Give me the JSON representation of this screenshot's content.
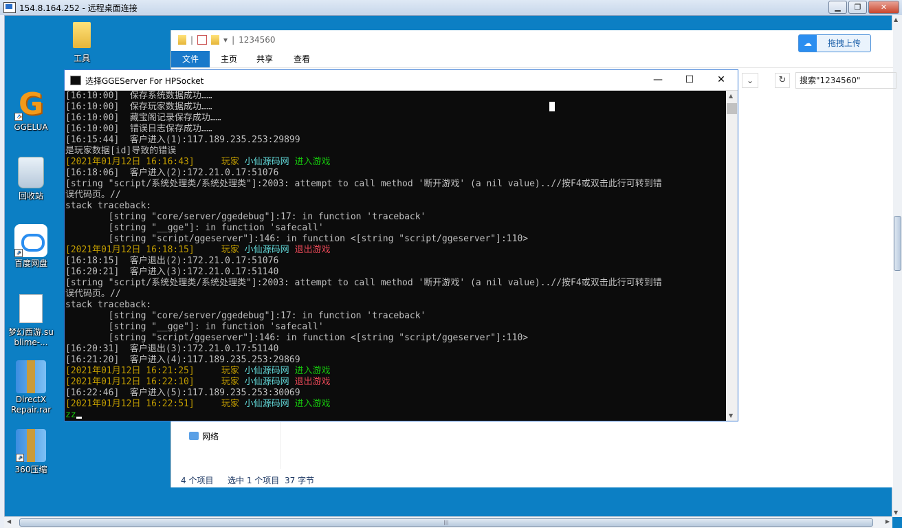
{
  "rdp": {
    "title": "154.8.164.252 - 远程桌面连接",
    "min": "▁",
    "restore": "❐",
    "close": "✕"
  },
  "desktop": {
    "icons": [
      {
        "label": "工具",
        "icon": "folder-icon"
      },
      {
        "label": "GGELUA",
        "icon": "ggelua-icon"
      },
      {
        "label": "回收站",
        "icon": "recycle-bin-icon"
      },
      {
        "label": "百度网盘",
        "icon": "baidu-netdisk-icon"
      },
      {
        "label": "梦幻西游.sublime-...",
        "icon": "file-icon"
      },
      {
        "label": "DirectX Repair.rar",
        "icon": "rar-icon"
      },
      {
        "label": "360压缩",
        "icon": "rar-icon"
      }
    ]
  },
  "explorer": {
    "path_label": "1234560",
    "upload_label": "拖拽上传",
    "tabs": [
      "文件",
      "主页",
      "共享",
      "查看"
    ],
    "search_placeholder": "搜索\"1234560\"",
    "nav_network": "网络",
    "status_items": "4 个项目",
    "status_selected": "选中 1 个项目",
    "status_size": "37 字节"
  },
  "console": {
    "title": "选择GGEServer For HPSocket",
    "lines": [
      [
        {
          "t": "[16:10:00]  保存系统数据成功……",
          "c": "gray"
        }
      ],
      [
        {
          "t": "[16:10:00]  保存玩家数据成功……",
          "c": "gray"
        }
      ],
      [
        {
          "t": "[16:10:00]  藏宝阁记录保存成功……",
          "c": "gray"
        }
      ],
      [
        {
          "t": "[16:10:00]  错误日志保存成功……",
          "c": "gray"
        }
      ],
      [
        {
          "t": "[16:15:44]  客户进入(1):117.189.235.253:29899",
          "c": "gray"
        }
      ],
      [
        {
          "t": "是玩家数据[id]导致的错误",
          "c": "gray"
        }
      ],
      [
        {
          "t": "[2021年01月12日 16:16:43]     ",
          "c": "yellow"
        },
        {
          "t": "玩家 ",
          "c": "yellow"
        },
        {
          "t": "小仙源码网 ",
          "c": "cyan"
        },
        {
          "t": "进入游戏",
          "c": "green"
        }
      ],
      [
        {
          "t": "[16:18:06]  客户进入(2):172.21.0.17:51076",
          "c": "gray"
        }
      ],
      [
        {
          "t": "[string \"script/系统处理类/系统处理类\"]:2003: attempt to call method '断开游戏' (a nil value)..//按F4或双击此行可转到错",
          "c": "gray"
        }
      ],
      [
        {
          "t": "误代码页。//",
          "c": "gray"
        }
      ],
      [
        {
          "t": "stack traceback:",
          "c": "gray"
        }
      ],
      [
        {
          "t": "        [string \"core/server/ggedebug\"]:17: in function 'traceback'",
          "c": "gray"
        }
      ],
      [
        {
          "t": "        [string \"__gge\"]: in function 'safecall'",
          "c": "gray"
        }
      ],
      [
        {
          "t": "        [string \"script/ggeserver\"]:146: in function <[string \"script/ggeserver\"]:110>",
          "c": "gray"
        }
      ],
      [
        {
          "t": "[2021年01月12日 16:18:15]     ",
          "c": "yellow"
        },
        {
          "t": "玩家 ",
          "c": "yellow"
        },
        {
          "t": "小仙源码网 ",
          "c": "cyan"
        },
        {
          "t": "退出游戏",
          "c": "red"
        }
      ],
      [
        {
          "t": "[16:18:15]  客户退出(2):172.21.0.17:51076",
          "c": "gray"
        }
      ],
      [
        {
          "t": "[16:20:21]  客户进入(3):172.21.0.17:51140",
          "c": "gray"
        }
      ],
      [
        {
          "t": "[string \"script/系统处理类/系统处理类\"]:2003: attempt to call method '断开游戏' (a nil value)..//按F4或双击此行可转到错",
          "c": "gray"
        }
      ],
      [
        {
          "t": "误代码页。//",
          "c": "gray"
        }
      ],
      [
        {
          "t": "stack traceback:",
          "c": "gray"
        }
      ],
      [
        {
          "t": "        [string \"core/server/ggedebug\"]:17: in function 'traceback'",
          "c": "gray"
        }
      ],
      [
        {
          "t": "        [string \"__gge\"]: in function 'safecall'",
          "c": "gray"
        }
      ],
      [
        {
          "t": "        [string \"script/ggeserver\"]:146: in function <[string \"script/ggeserver\"]:110>",
          "c": "gray"
        }
      ],
      [
        {
          "t": "[16:20:31]  客户退出(3):172.21.0.17:51140",
          "c": "gray"
        }
      ],
      [
        {
          "t": "[16:21:20]  客户进入(4):117.189.235.253:29869",
          "c": "gray"
        }
      ],
      [
        {
          "t": "[2021年01月12日 16:21:25]     ",
          "c": "yellow"
        },
        {
          "t": "玩家 ",
          "c": "yellow"
        },
        {
          "t": "小仙源码网 ",
          "c": "cyan"
        },
        {
          "t": "进入游戏",
          "c": "green"
        }
      ],
      [
        {
          "t": "[2021年01月12日 16:22:10]     ",
          "c": "yellow"
        },
        {
          "t": "玩家 ",
          "c": "yellow"
        },
        {
          "t": "小仙源码网 ",
          "c": "cyan"
        },
        {
          "t": "退出游戏",
          "c": "red"
        }
      ],
      [
        {
          "t": "[16:22:46]  客户进入(5):117.189.235.253:30069",
          "c": "gray"
        }
      ],
      [
        {
          "t": "[2021年01月12日 16:22:51]     ",
          "c": "yellow"
        },
        {
          "t": "玩家 ",
          "c": "yellow"
        },
        {
          "t": "小仙源码网 ",
          "c": "cyan"
        },
        {
          "t": "进入游戏",
          "c": "green"
        }
      ],
      [
        {
          "t": "zz",
          "c": "green"
        }
      ]
    ]
  },
  "colors": {
    "desktop_bg": "#0c7fc4",
    "console_bg": "#0c0c0c",
    "explorer_file_tab": "#1979ca"
  }
}
